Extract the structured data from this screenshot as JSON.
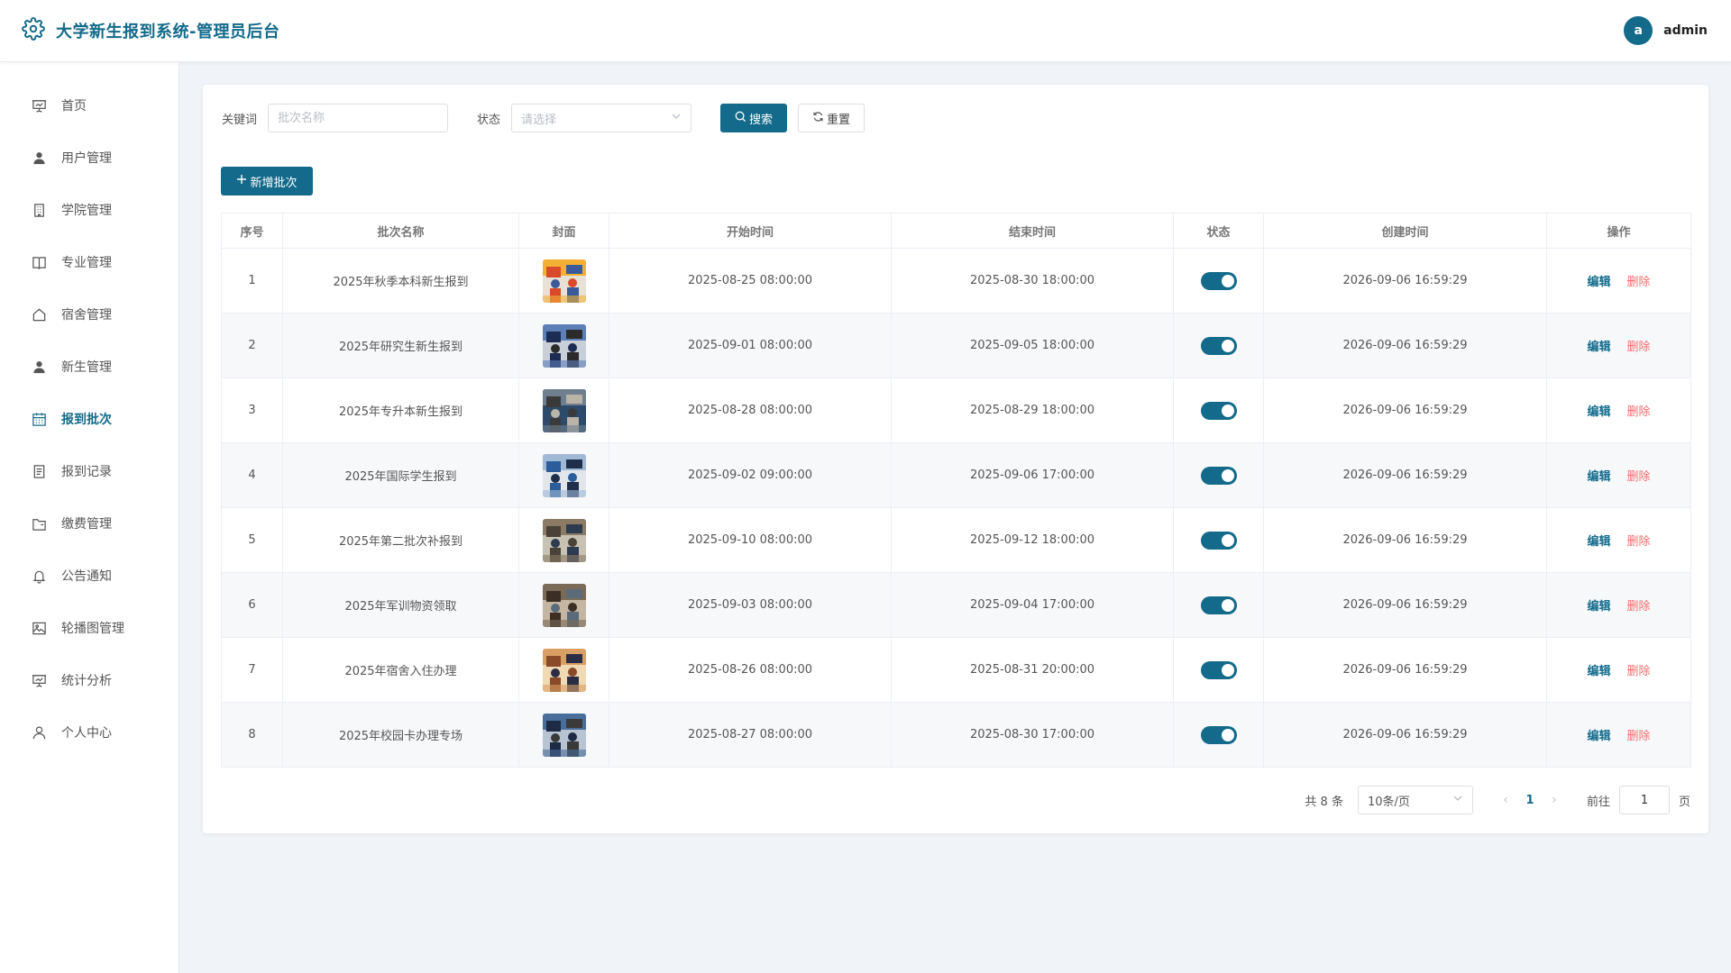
{
  "header": {
    "title": "大学新生报到系统-管理员后台",
    "avatar_letter": "a",
    "username": "admin"
  },
  "sidebar": {
    "items": [
      {
        "label": "首页",
        "icon": "presentation-board-icon"
      },
      {
        "label": "用户管理",
        "icon": "user-icon"
      },
      {
        "label": "学院管理",
        "icon": "building-icon"
      },
      {
        "label": "专业管理",
        "icon": "book-icon"
      },
      {
        "label": "宿舍管理",
        "icon": "house-icon"
      },
      {
        "label": "新生管理",
        "icon": "user-icon"
      },
      {
        "label": "报到批次",
        "icon": "calendar-icon",
        "active": true
      },
      {
        "label": "报到记录",
        "icon": "document-icon"
      },
      {
        "label": "缴费管理",
        "icon": "folder-icon"
      },
      {
        "label": "公告通知",
        "icon": "bell-icon"
      },
      {
        "label": "轮播图管理",
        "icon": "picture-icon"
      },
      {
        "label": "统计分析",
        "icon": "presentation-board-icon"
      },
      {
        "label": "个人中心",
        "icon": "user-outline-icon"
      }
    ]
  },
  "filters": {
    "keyword_label": "关键词",
    "keyword_value": "",
    "keyword_placeholder": "批次名称",
    "status_label": "状态",
    "status_placeholder": "请选择",
    "search_label": "搜索",
    "reset_label": "重置"
  },
  "actions": {
    "add_label": "新增批次"
  },
  "table": {
    "columns": [
      "序号",
      "批次名称",
      "封面",
      "开始时间",
      "结束时间",
      "状态",
      "创建时间",
      "操作"
    ],
    "edit_label": "编辑",
    "delete_label": "删除",
    "rows": [
      {
        "index": "1",
        "name": "2025年秋季本科新生报到",
        "start": "2025-08-25 08:00:00",
        "end": "2025-08-30 18:00:00",
        "enabled": true,
        "created": "2026-09-06 16:59:29"
      },
      {
        "index": "2",
        "name": "2025年研究生新生报到",
        "start": "2025-09-01 08:00:00",
        "end": "2025-09-05 18:00:00",
        "enabled": true,
        "created": "2026-09-06 16:59:29"
      },
      {
        "index": "3",
        "name": "2025年专升本新生报到",
        "start": "2025-08-28 08:00:00",
        "end": "2025-08-29 18:00:00",
        "enabled": true,
        "created": "2026-09-06 16:59:29"
      },
      {
        "index": "4",
        "name": "2025年国际学生报到",
        "start": "2025-09-02 09:00:00",
        "end": "2025-09-06 17:00:00",
        "enabled": true,
        "created": "2026-09-06 16:59:29"
      },
      {
        "index": "5",
        "name": "2025年第二批次补报到",
        "start": "2025-09-10 08:00:00",
        "end": "2025-09-12 18:00:00",
        "enabled": true,
        "created": "2026-09-06 16:59:29"
      },
      {
        "index": "6",
        "name": "2025年军训物资领取",
        "start": "2025-09-03 08:00:00",
        "end": "2025-09-04 17:00:00",
        "enabled": true,
        "created": "2026-09-06 16:59:29"
      },
      {
        "index": "7",
        "name": "2025年宿舍入住办理",
        "start": "2025-08-26 08:00:00",
        "end": "2025-08-31 20:00:00",
        "enabled": true,
        "created": "2026-09-06 16:59:29"
      },
      {
        "index": "8",
        "name": "2025年校园卡办理专场",
        "start": "2025-08-27 08:00:00",
        "end": "2025-08-30 17:00:00",
        "enabled": true,
        "created": "2026-09-06 16:59:29"
      }
    ]
  },
  "pagination": {
    "total_text": "共 8 条",
    "page_size": "10条/页",
    "current_page": "1",
    "goto_label": "前往",
    "goto_value": "1",
    "page_suffix": "页"
  },
  "colors": {
    "primary": "#136a8a",
    "danger": "#f56c6c",
    "background": "#f0f3f7"
  }
}
